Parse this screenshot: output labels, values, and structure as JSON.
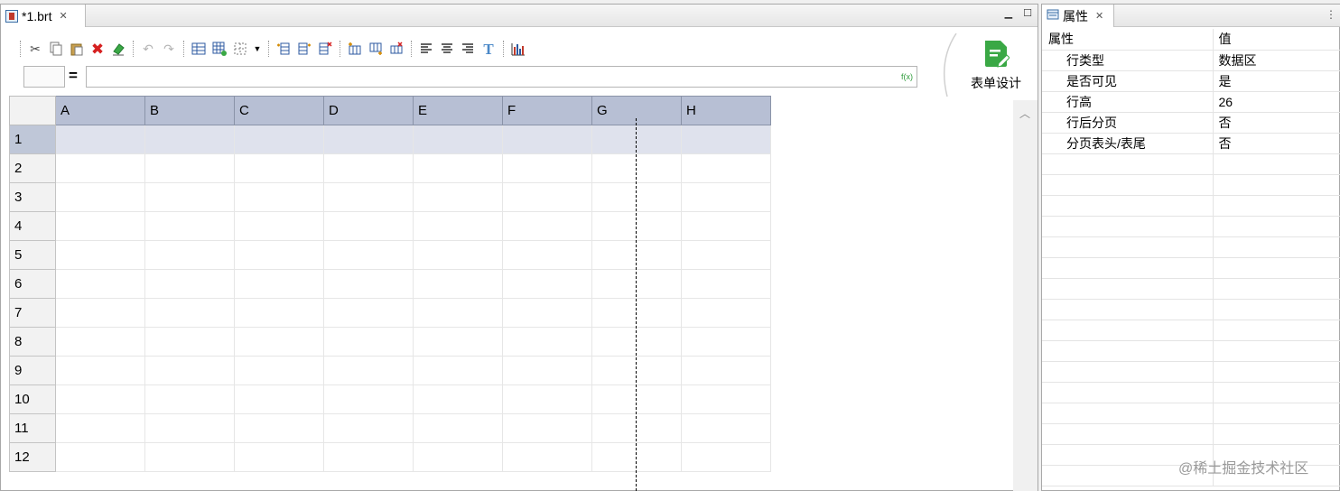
{
  "editor": {
    "tab_title": "*1.brt",
    "toolbar_icons": [
      "cut-icon",
      "copy-icon",
      "paste-icon",
      "delete-icon",
      "eraser-icon",
      "undo-icon",
      "redo-icon",
      "insert-table-icon",
      "add-table-icon",
      "grid-border-icon",
      "dropdown-icon",
      "insert-column-left-icon",
      "insert-column-right-icon",
      "delete-column-icon",
      "insert-row-above-icon",
      "insert-row-below-icon",
      "delete-row-icon",
      "align-left-icon",
      "align-center-icon",
      "align-right-icon",
      "text-style-icon",
      "chart-icon"
    ],
    "formula": {
      "cell_name": "",
      "equals": "=",
      "value": "",
      "fx": "f(x)"
    },
    "form_design_label": "表单设计",
    "columns": [
      "A",
      "B",
      "C",
      "D",
      "E",
      "F",
      "G",
      "H"
    ],
    "rows": [
      "1",
      "2",
      "3",
      "4",
      "5",
      "6",
      "7",
      "8",
      "9",
      "10",
      "11",
      "12"
    ],
    "selected_row": "1"
  },
  "properties": {
    "tab_title": "属性",
    "header": {
      "key": "属性",
      "value": "值"
    },
    "items": [
      {
        "key": "行类型",
        "value": "数据区"
      },
      {
        "key": "是否可见",
        "value": "是"
      },
      {
        "key": "行高",
        "value": "26"
      },
      {
        "key": "行后分页",
        "value": "否"
      },
      {
        "key": "分页表头/表尾",
        "value": "否"
      }
    ]
  },
  "watermark": "@稀土掘金技术社区",
  "colors": {
    "column_header": "#b7bfd4",
    "selected_row": "#dfe2ed",
    "form_design_icon": "#3aa845"
  }
}
